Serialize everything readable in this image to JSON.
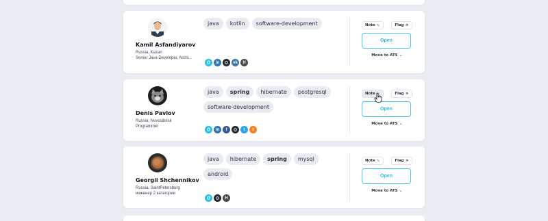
{
  "candidates": [
    {
      "name": "Kamil Asfandiyarov",
      "location": "Russia, Kazan",
      "title": "Senior Java Developer, Archi...",
      "tags": [
        {
          "label": "java",
          "bold": false
        },
        {
          "label": "kotlin",
          "bold": false
        },
        {
          "label": "software-development",
          "bold": false
        }
      ],
      "socials": [
        "email-icon",
        "linkedin-icon",
        "github-icon",
        "vk-icon",
        "habr-icon"
      ]
    },
    {
      "name": "Denis Pavlov",
      "location": "Russia, Novosibirsk",
      "title": "Programmer",
      "tags": [
        {
          "label": "java",
          "bold": false
        },
        {
          "label": "spring",
          "bold": true
        },
        {
          "label": "hibernate",
          "bold": false
        },
        {
          "label": "postgresql",
          "bold": false
        },
        {
          "label": "software-development",
          "bold": false
        }
      ],
      "socials": [
        "email-icon",
        "linkedin-icon",
        "facebook-icon",
        "github-icon",
        "twitter-icon",
        "stackoverflow-icon"
      ]
    },
    {
      "name": "Georgii Shchennikov",
      "location": "Russia, SaintPetersburg",
      "title": "инженер 2 категории",
      "tags": [
        {
          "label": "java",
          "bold": false
        },
        {
          "label": "hibernate",
          "bold": false
        },
        {
          "label": "spring",
          "bold": true
        },
        {
          "label": "mysql",
          "bold": false
        },
        {
          "label": "android",
          "bold": false
        }
      ],
      "socials": [
        "email-icon",
        "github-icon",
        "habr-icon"
      ]
    }
  ],
  "actions": {
    "note_label": "Note",
    "flag_label": "Flag",
    "open_label": "Open",
    "ats_label": "Move to ATS"
  },
  "colors": {
    "accent": "#2bbfe0",
    "background": "#e9edf1"
  }
}
